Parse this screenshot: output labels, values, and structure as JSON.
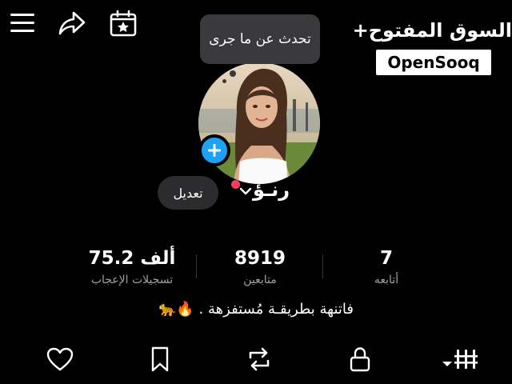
{
  "watermark": {
    "arabic": "السوق المفتوح+",
    "english": "OpenSooq"
  },
  "bubble": {
    "text": "تحدث عن ما جرى"
  },
  "profile": {
    "name": "رنـؤ",
    "edit_label": "تعديل"
  },
  "stats": {
    "likes": {
      "value": "75.2 ألف",
      "label": "تسجيلات الإعجاب"
    },
    "followers": {
      "value": "8919",
      "label": "متابعين"
    },
    "following": {
      "value": "7",
      "label": "أتابعه"
    }
  },
  "bio": "فاتنهة بطريقـة مُستفزهة . 🔥🐆",
  "icons": {
    "menu": "menu-icon",
    "share": "share-icon",
    "calendar": "calendar-star-icon",
    "add": "plus-icon",
    "chevron": "chevron-down-icon",
    "tabs": [
      "heart-icon",
      "bookmark-icon",
      "repost-icon",
      "lock-icon",
      "grid-icon"
    ]
  },
  "colors": {
    "background": "#000000",
    "accent_blue": "#1da1f2",
    "status_dot": "#ff3b5c",
    "chip": "#2c2c2e"
  }
}
